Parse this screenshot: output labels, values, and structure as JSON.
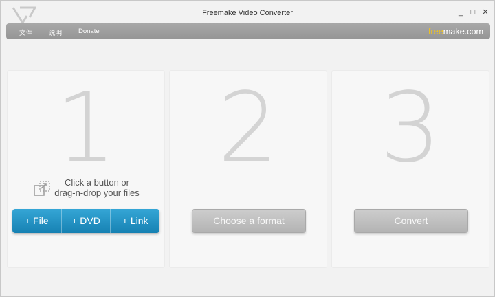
{
  "window": {
    "title": "Freemake Video Converter",
    "minimize": "_",
    "maximize": "□",
    "close": "✕"
  },
  "menu": {
    "items": [
      "文件",
      "说明",
      "Donate"
    ],
    "brand_free": "free",
    "brand_rest": "make.com"
  },
  "steps": [
    {
      "number": "1",
      "hint_line1": "Click a button or",
      "hint_line2": "drag-n-drop your files",
      "buttons": [
        "+ File",
        "+ DVD",
        "+ Link"
      ]
    },
    {
      "number": "2",
      "button": "Choose a format"
    },
    {
      "number": "3",
      "button": "Convert"
    }
  ],
  "colors": {
    "accent_blue": "#1e8fc4",
    "brand_yellow": "#f5c518",
    "menubar_gray": "#9e9e9e"
  },
  "icons": [
    "freemake-logo-icon",
    "drag-drop-icon"
  ]
}
